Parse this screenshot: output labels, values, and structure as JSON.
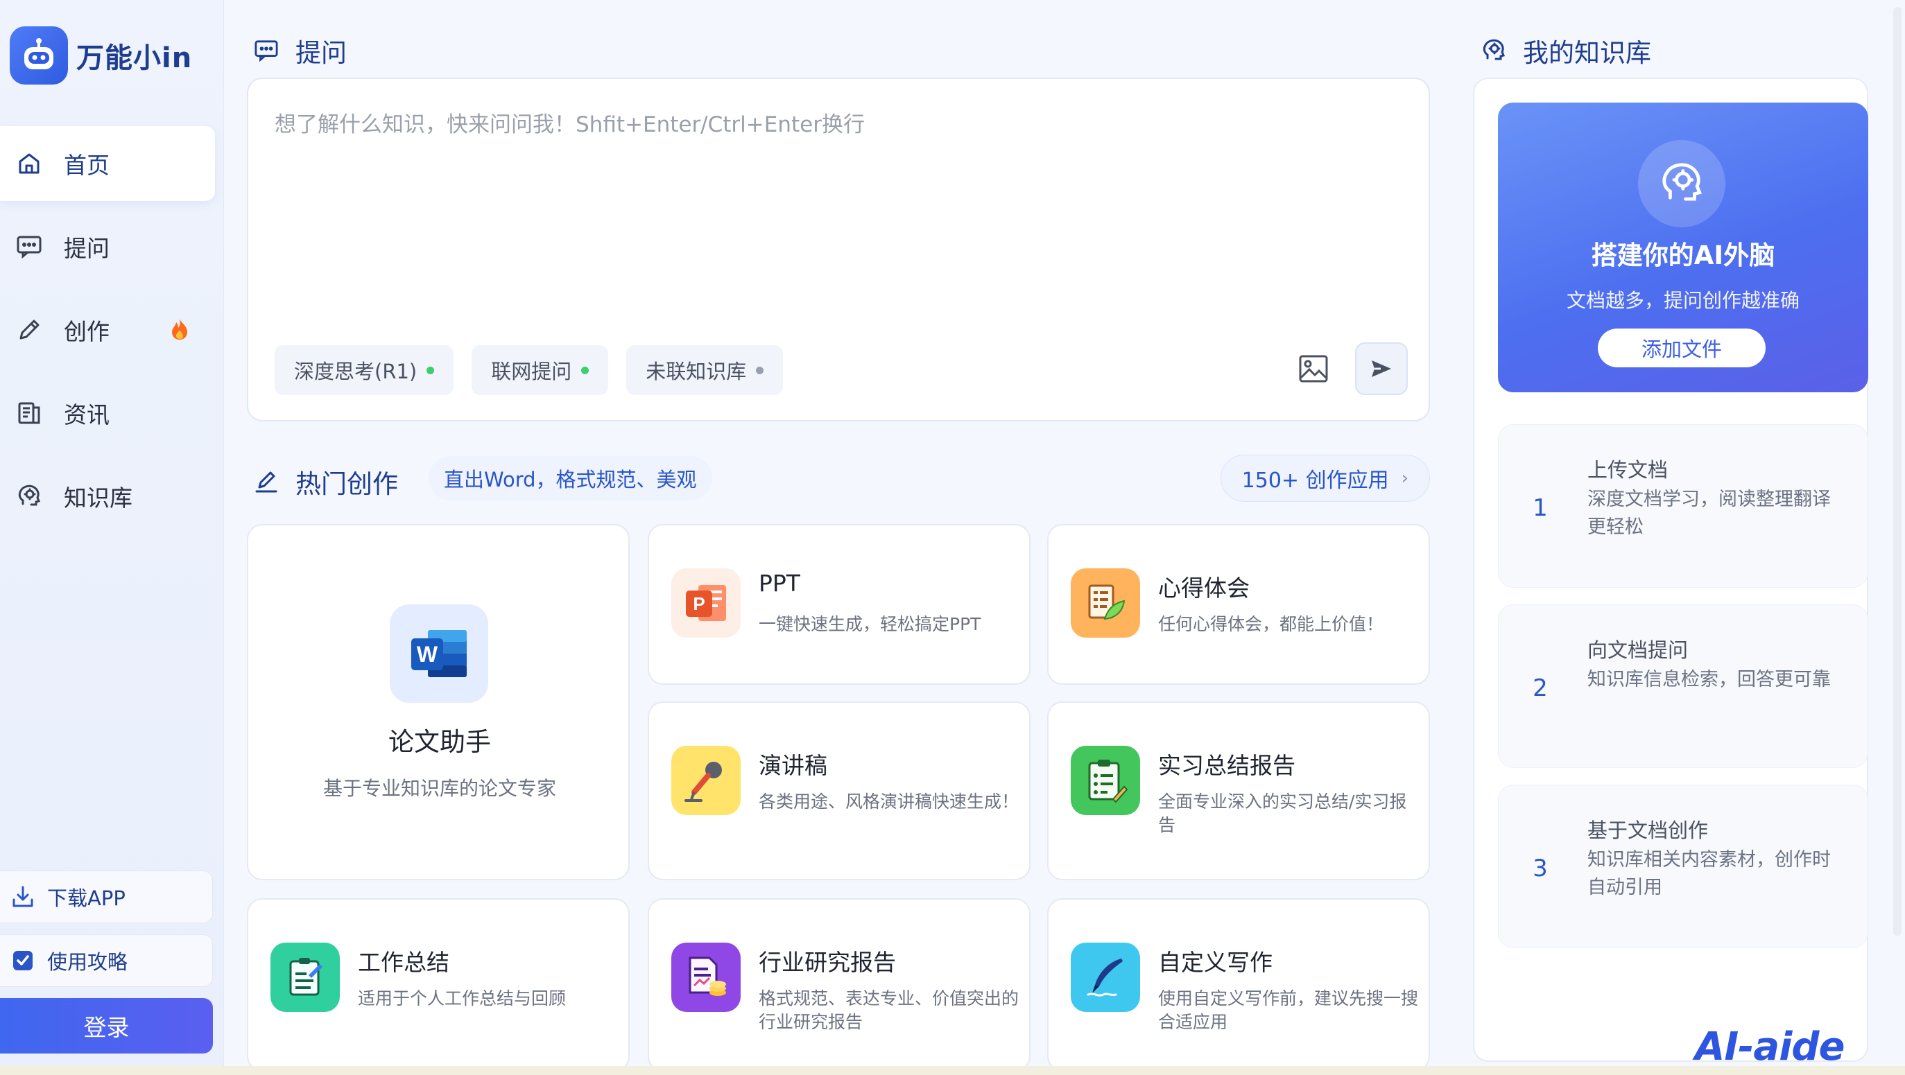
{
  "brand": {
    "name": "万能小in",
    "logo_icon": "robot-icon"
  },
  "sidebar": {
    "items": [
      {
        "label": "首页",
        "icon": "home-icon",
        "active": true
      },
      {
        "label": "提问",
        "icon": "chat-icon"
      },
      {
        "label": "创作",
        "icon": "pencil-icon",
        "badge": "fire-icon"
      },
      {
        "label": "资讯",
        "icon": "news-icon"
      },
      {
        "label": "知识库",
        "icon": "brain-icon"
      }
    ],
    "download_app": "下载APP",
    "guide": "使用攻略",
    "login": "登录"
  },
  "ask": {
    "title": "提问",
    "placeholder": "想了解什么知识，快来问问我！Shfit+Enter/Ctrl+Enter换行",
    "chips": [
      {
        "label": "深度思考(R1)",
        "dot_color": "#3ccf6e"
      },
      {
        "label": "联网提问",
        "dot_color": "#3ccf6e"
      },
      {
        "label": "未联知识库",
        "dot_color": "#9aa0ab"
      }
    ]
  },
  "hot": {
    "title": "热门创作",
    "tag": "直出Word，格式规范、美观",
    "more": "150+ 创作应用",
    "featured": {
      "title": "论文助手",
      "desc": "基于专业知识库的论文专家",
      "icon": "word-icon"
    },
    "cards": [
      {
        "title": "PPT",
        "desc": "一键快速生成，轻松搞定PPT",
        "icon": "ppt-icon"
      },
      {
        "title": "心得体会",
        "desc": "任何心得体会，都能上价值！",
        "icon": "notes-leaf-icon"
      },
      {
        "title": "演讲稿",
        "desc": "各类用途、风格演讲稿快速生成！",
        "icon": "microphone-icon"
      },
      {
        "title": "实习总结报告",
        "desc": "全面专业深入的实习总结/实习报告",
        "icon": "clipboard-icon"
      },
      {
        "title": "工作总结",
        "desc": "适用于个人工作总结与回顾",
        "icon": "summary-icon"
      },
      {
        "title": "行业研究报告",
        "desc": "格式规范、表达专业、价值突出的行业研究报告",
        "icon": "report-coin-icon"
      },
      {
        "title": "自定义写作",
        "desc": "使用自定义写作前，建议先搜一搜合适应用",
        "icon": "quill-icon"
      }
    ]
  },
  "kb": {
    "title": "我的知识库",
    "hero_title": "搭建你的AI外脑",
    "hero_desc": "文档越多，提问创作越准确",
    "hero_button": "添加文件",
    "steps": [
      {
        "num": "1",
        "title": "上传文档",
        "desc": "深度文档学习，阅读整理翻译更轻松"
      },
      {
        "num": "2",
        "title": "向文档提问",
        "desc": "知识库信息检索，回答更可靠"
      },
      {
        "num": "3",
        "title": "基于文档创作",
        "desc": "知识库相关内容素材，创作时自动引用"
      }
    ]
  },
  "watermark": "AI-aide",
  "colors": {
    "brand": "#1f3d8f",
    "accent": "#3f67ef",
    "hero": "#5a7cf2"
  }
}
